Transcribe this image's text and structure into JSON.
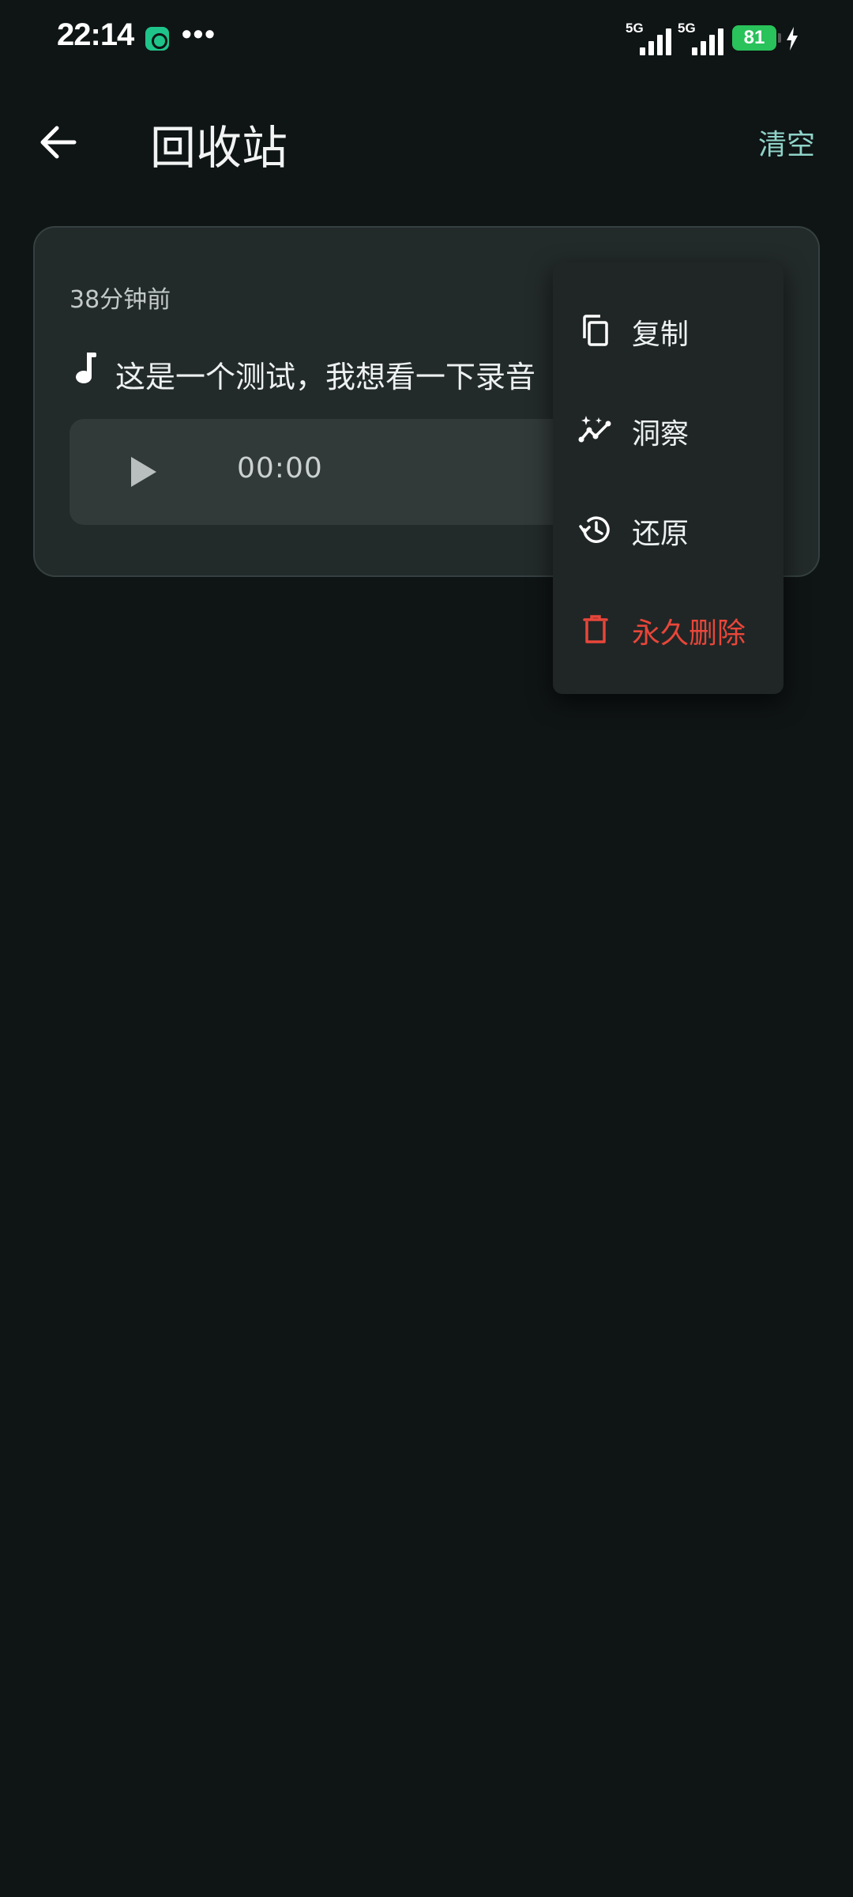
{
  "status_bar": {
    "time": "22:14",
    "dots": "•••",
    "network1": "5G",
    "network2": "5G",
    "battery": "81",
    "accent_battery": "#29c25b"
  },
  "header": {
    "title": "回收站",
    "clear_label": "清空",
    "back_icon": "arrow-left-icon"
  },
  "recording": {
    "time_ago": "38分钟前",
    "transcript": "这是一个测试，我想看一下录音",
    "duration": "00:00"
  },
  "menu": {
    "items": [
      {
        "label": "复制",
        "icon": "copy-icon"
      },
      {
        "label": "洞察",
        "icon": "insight-icon"
      },
      {
        "label": "还原",
        "icon": "restore-icon"
      },
      {
        "label": "永久删除",
        "icon": "trash-icon",
        "color": "#e8463a"
      }
    ]
  },
  "colors": {
    "background": "#0f1414",
    "card": "#232a2a",
    "accent": "#8fd3c9",
    "danger": "#e8463a"
  }
}
